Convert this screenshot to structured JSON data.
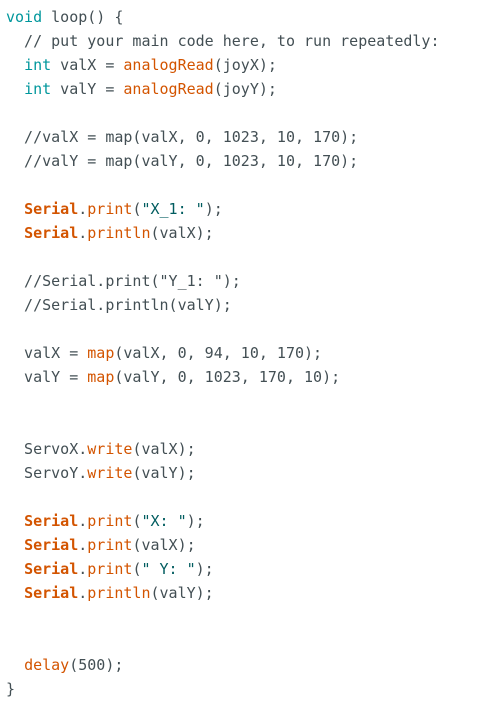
{
  "editor": {
    "colors": {
      "background": "#ffffff",
      "plain": "#434f54",
      "keyword": "#00979c",
      "function": "#d35400",
      "string": "#005c5f",
      "comment": "#434f54"
    },
    "lines": [
      {
        "tokens": [
          {
            "t": "void",
            "c": "kw"
          },
          {
            "t": " loop() {",
            "c": "pl"
          }
        ]
      },
      {
        "tokens": [
          {
            "t": "  // put your main code here, to run repeatedly:",
            "c": "cm"
          }
        ]
      },
      {
        "tokens": [
          {
            "t": "  ",
            "c": "pl"
          },
          {
            "t": "int",
            "c": "kw"
          },
          {
            "t": " valX = ",
            "c": "pl"
          },
          {
            "t": "analogRead",
            "c": "fn"
          },
          {
            "t": "(joyX);",
            "c": "pl"
          }
        ]
      },
      {
        "tokens": [
          {
            "t": "  ",
            "c": "pl"
          },
          {
            "t": "int",
            "c": "kw"
          },
          {
            "t": " valY = ",
            "c": "pl"
          },
          {
            "t": "analogRead",
            "c": "fn"
          },
          {
            "t": "(joyY);",
            "c": "pl"
          }
        ]
      },
      {
        "tokens": []
      },
      {
        "tokens": [
          {
            "t": "  //valX = map(valX, 0, 1023, 10, 170);",
            "c": "cm"
          }
        ]
      },
      {
        "tokens": [
          {
            "t": "  //valY = map(valY, 0, 1023, 10, 170);",
            "c": "cm"
          }
        ]
      },
      {
        "tokens": []
      },
      {
        "tokens": [
          {
            "t": "  ",
            "c": "pl"
          },
          {
            "t": "Serial",
            "c": "bold"
          },
          {
            "t": ".",
            "c": "pl"
          },
          {
            "t": "print",
            "c": "fn"
          },
          {
            "t": "(",
            "c": "pl"
          },
          {
            "t": "\"X_1: \"",
            "c": "str"
          },
          {
            "t": ");",
            "c": "pl"
          }
        ]
      },
      {
        "tokens": [
          {
            "t": "  ",
            "c": "pl"
          },
          {
            "t": "Serial",
            "c": "bold"
          },
          {
            "t": ".",
            "c": "pl"
          },
          {
            "t": "println",
            "c": "fn"
          },
          {
            "t": "(valX);",
            "c": "pl"
          }
        ]
      },
      {
        "tokens": []
      },
      {
        "tokens": [
          {
            "t": "  //Serial.print(\"Y_1: \");",
            "c": "cm"
          }
        ]
      },
      {
        "tokens": [
          {
            "t": "  //Serial.println(valY);",
            "c": "cm"
          }
        ]
      },
      {
        "tokens": []
      },
      {
        "tokens": [
          {
            "t": "  valX = ",
            "c": "pl"
          },
          {
            "t": "map",
            "c": "fn"
          },
          {
            "t": "(valX, 0, 94, 10, 170);",
            "c": "pl"
          }
        ]
      },
      {
        "tokens": [
          {
            "t": "  valY = ",
            "c": "pl"
          },
          {
            "t": "map",
            "c": "fn"
          },
          {
            "t": "(valY, 0, 1023, 170, 10);",
            "c": "pl"
          }
        ]
      },
      {
        "tokens": []
      },
      {
        "tokens": []
      },
      {
        "tokens": [
          {
            "t": "  ServoX.",
            "c": "pl"
          },
          {
            "t": "write",
            "c": "fn"
          },
          {
            "t": "(valX);",
            "c": "pl"
          }
        ]
      },
      {
        "tokens": [
          {
            "t": "  ServoY.",
            "c": "pl"
          },
          {
            "t": "write",
            "c": "fn"
          },
          {
            "t": "(valY);",
            "c": "pl"
          }
        ]
      },
      {
        "tokens": []
      },
      {
        "tokens": [
          {
            "t": "  ",
            "c": "pl"
          },
          {
            "t": "Serial",
            "c": "bold"
          },
          {
            "t": ".",
            "c": "pl"
          },
          {
            "t": "print",
            "c": "fn"
          },
          {
            "t": "(",
            "c": "pl"
          },
          {
            "t": "\"X: \"",
            "c": "str"
          },
          {
            "t": ");",
            "c": "pl"
          }
        ]
      },
      {
        "tokens": [
          {
            "t": "  ",
            "c": "pl"
          },
          {
            "t": "Serial",
            "c": "bold"
          },
          {
            "t": ".",
            "c": "pl"
          },
          {
            "t": "print",
            "c": "fn"
          },
          {
            "t": "(valX);",
            "c": "pl"
          }
        ]
      },
      {
        "tokens": [
          {
            "t": "  ",
            "c": "pl"
          },
          {
            "t": "Serial",
            "c": "bold"
          },
          {
            "t": ".",
            "c": "pl"
          },
          {
            "t": "print",
            "c": "fn"
          },
          {
            "t": "(",
            "c": "pl"
          },
          {
            "t": "\" Y: \"",
            "c": "str"
          },
          {
            "t": ");",
            "c": "pl"
          }
        ]
      },
      {
        "tokens": [
          {
            "t": "  ",
            "c": "pl"
          },
          {
            "t": "Serial",
            "c": "bold"
          },
          {
            "t": ".",
            "c": "pl"
          },
          {
            "t": "println",
            "c": "fn"
          },
          {
            "t": "(valY);",
            "c": "pl"
          }
        ]
      },
      {
        "tokens": []
      },
      {
        "tokens": []
      },
      {
        "tokens": [
          {
            "t": "  ",
            "c": "pl"
          },
          {
            "t": "delay",
            "c": "fn"
          },
          {
            "t": "(500);",
            "c": "pl"
          }
        ]
      },
      {
        "tokens": [
          {
            "t": "}",
            "c": "pl"
          }
        ]
      }
    ]
  }
}
